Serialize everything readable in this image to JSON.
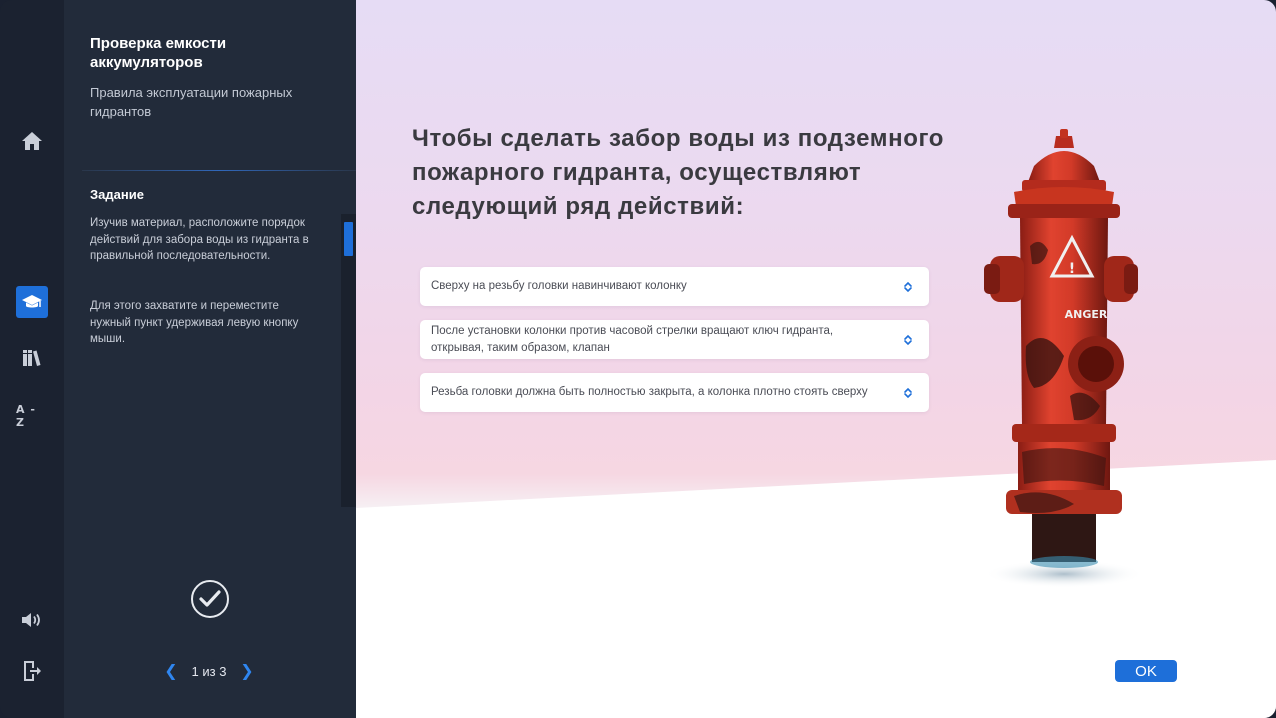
{
  "sidebar": {
    "course_title": "Проверка емкости аккумуляторов",
    "course_subtitle": "Правила эксплуатации пожарных гидрантов",
    "task_heading": "Задание",
    "task_text_1": "Изучив материал, расположите порядок действий для забора воды из гидранта в правильной последовательности.",
    "task_text_2": "Для этого захватите и переместите нужный пункт удерживая левую кнопку мыши.",
    "pager": {
      "text": "1 из 3"
    }
  },
  "rail": {
    "icons": [
      "home-icon",
      "graduation-cap-icon",
      "library-icon",
      "az-glossary-icon",
      "volume-icon",
      "exit-icon"
    ],
    "glossary_label": "A - Z"
  },
  "main": {
    "question": "Чтобы сделать забор воды из подземного пожарного гидранта, осуществляют следующий ряд действий:",
    "options": [
      {
        "text": "Сверху на резьбу головки навинчивают колонку"
      },
      {
        "text": "После установки колонки против часовой стрелки вращают ключ гидранта, открывая, таким образом, клапан"
      },
      {
        "text": "Резьба головки должна быть полностью закрыта, а колонка плотно стоять сверху"
      }
    ],
    "ok_label": "OK",
    "hydrant_sign_text": "ANGER"
  },
  "colors": {
    "accent": "#1e6fd9",
    "rail_bg": "#1b2230",
    "panel_bg": "#222b3a",
    "hydrant_red": "#d9392a"
  }
}
